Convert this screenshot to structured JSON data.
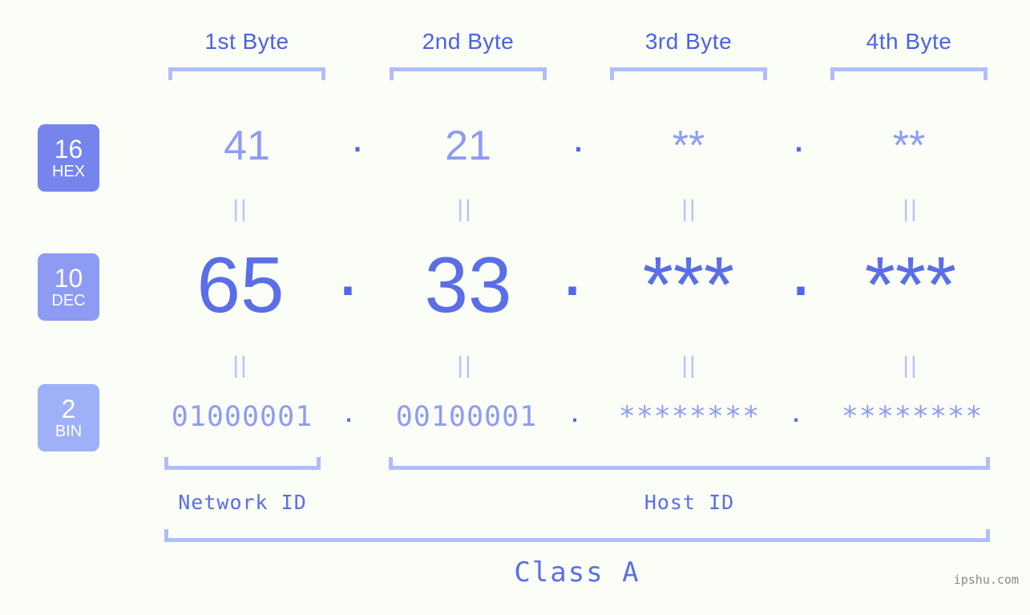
{
  "meta": {
    "background_color": "#fbfdf7",
    "accent_strong": "#5a6ee8",
    "accent_mid": "#8e9cf3",
    "accent_light": "#b0bdfc",
    "watermark": "ipshu.com"
  },
  "byte_headers": [
    {
      "label": "1st Byte"
    },
    {
      "label": "2nd Byte"
    },
    {
      "label": "3rd Byte"
    },
    {
      "label": "4th Byte"
    }
  ],
  "radix_rows": [
    {
      "badge_number": "16",
      "badge_name": "HEX",
      "badge_color": "#7684ee",
      "values": [
        "41",
        "21",
        "**",
        "**"
      ],
      "separator": "."
    },
    {
      "badge_number": "10",
      "badge_name": "DEC",
      "badge_color": "#8d9bf2",
      "values": [
        "65",
        "33",
        "***",
        "***"
      ],
      "separator": "."
    },
    {
      "badge_number": "2",
      "badge_name": "BIN",
      "badge_color": "#9db0f8",
      "values": [
        "01000001",
        "00100001",
        "********",
        "********"
      ],
      "separator": "."
    }
  ],
  "equality_marks": {
    "symbol": "||",
    "count_per_gap": 4
  },
  "id_sections": [
    {
      "label": "Network ID"
    },
    {
      "label": "Host ID"
    }
  ],
  "class_section": {
    "label": "Class A"
  }
}
